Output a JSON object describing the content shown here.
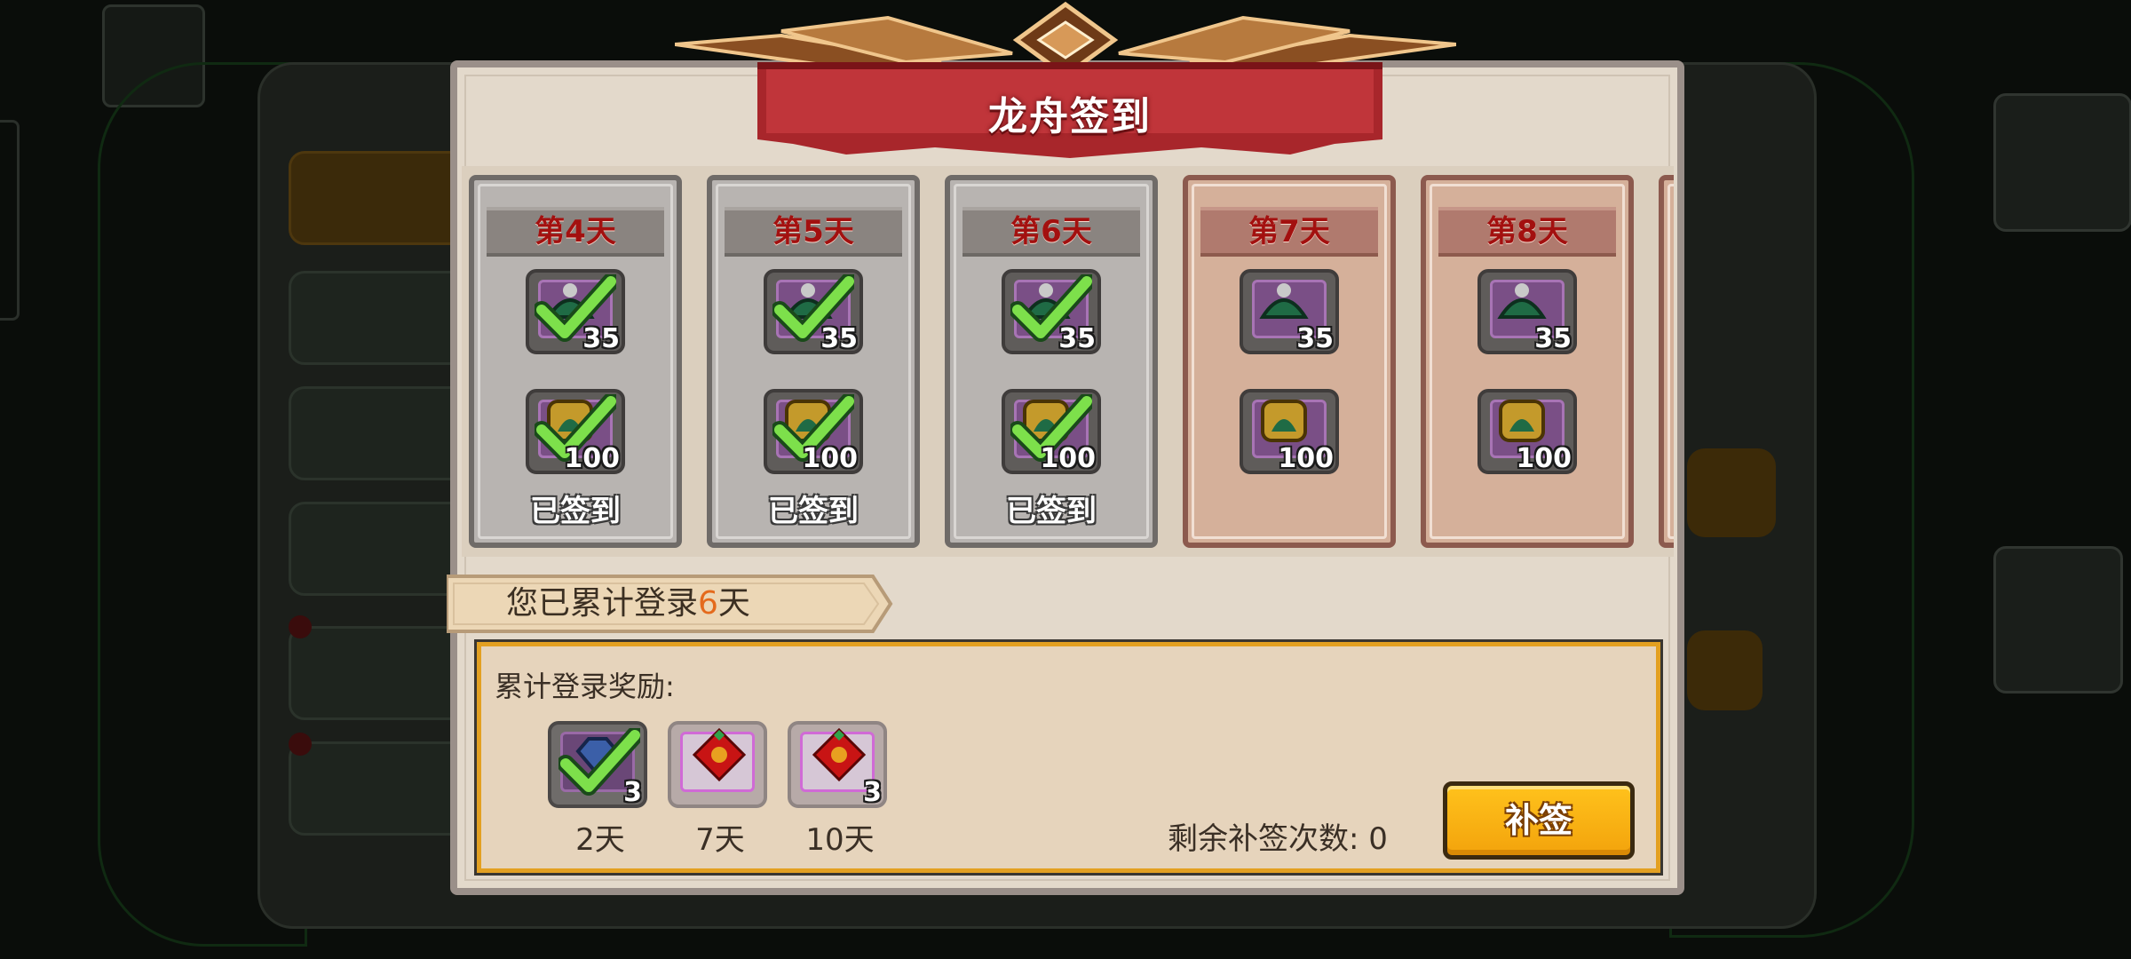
{
  "dialog": {
    "title": "龙舟签到",
    "days": [
      {
        "label": "第4天",
        "claimed": true,
        "status": "已签到",
        "rewards": [
          {
            "icon": "green-gem-icon",
            "count": "35"
          },
          {
            "icon": "gold-gem-icon",
            "count": "100"
          }
        ]
      },
      {
        "label": "第5天",
        "claimed": true,
        "status": "已签到",
        "rewards": [
          {
            "icon": "green-gem-icon",
            "count": "35"
          },
          {
            "icon": "gold-gem-icon",
            "count": "100"
          }
        ]
      },
      {
        "label": "第6天",
        "claimed": true,
        "status": "已签到",
        "rewards": [
          {
            "icon": "green-gem-icon",
            "count": "35"
          },
          {
            "icon": "gold-gem-icon",
            "count": "100"
          }
        ]
      },
      {
        "label": "第7天",
        "claimed": false,
        "status": "",
        "rewards": [
          {
            "icon": "green-gem-icon",
            "count": "35"
          },
          {
            "icon": "gold-gem-icon",
            "count": "100"
          }
        ]
      },
      {
        "label": "第8天",
        "claimed": false,
        "status": "",
        "rewards": [
          {
            "icon": "green-gem-icon",
            "count": "35"
          },
          {
            "icon": "gold-gem-icon",
            "count": "100"
          }
        ]
      }
    ],
    "cumulative": {
      "prefix": "您已累计登录",
      "days": "6",
      "suffix": "天"
    },
    "reward_title": "累计登录奖励:",
    "milestones": [
      {
        "icon": "blue-gem-icon",
        "count": "3",
        "label": "2天",
        "claimed": true
      },
      {
        "icon": "red-knot-icon",
        "count": "",
        "label": "7天",
        "claimed": false
      },
      {
        "icon": "red-knot-icon",
        "count": "3",
        "label": "10天",
        "claimed": false
      }
    ],
    "remaining_label": "剩余补签次数:",
    "remaining_count": "0",
    "makeup_button": "补签"
  },
  "colors": {
    "accent": "#f3a30c",
    "title_red": "#a11414",
    "cumulative_orange": "#e46a1c"
  }
}
